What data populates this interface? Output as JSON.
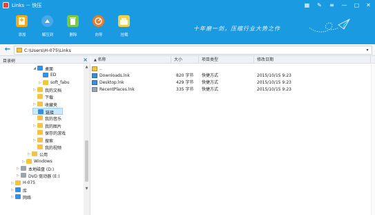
{
  "window": {
    "title": "Links － 快压",
    "controls": [
      "grid-icon",
      "wrench-icon",
      "menu-icon",
      "minimize-icon",
      "maximize-icon",
      "close-icon"
    ]
  },
  "toolbar": {
    "buttons": [
      {
        "label": "添加",
        "icon": "add-icon",
        "color": "#f5a623"
      },
      {
        "label": "解压到",
        "icon": "extract-icon",
        "color": "#4aa8ea"
      },
      {
        "label": "删除",
        "icon": "delete-icon",
        "color": "#7ac943"
      },
      {
        "label": "向导",
        "icon": "wizard-icon",
        "color": "#f07a2a"
      },
      {
        "label": "挂载",
        "icon": "mount-icon",
        "color": "#f1d04a"
      }
    ]
  },
  "slogan": "十年磨一剑，压缩行业大势之作",
  "address": {
    "path": "C:\\Users\\H-075\\Links"
  },
  "tree": {
    "title": "目录树",
    "items": [
      {
        "label": "桌面",
        "depth": 3,
        "expand": "◢",
        "icon": "#3a8fd8"
      },
      {
        "label": "ED",
        "depth": 4,
        "expand": "",
        "icon": "#3a8fd8"
      },
      {
        "label": "soft_fabu",
        "depth": 4,
        "expand": "▷",
        "icon": "#f3c443"
      },
      {
        "label": "我的文档",
        "depth": 3,
        "expand": "▷",
        "icon": "#f3c443"
      },
      {
        "label": "下载",
        "depth": 3,
        "expand": "",
        "icon": "#f3c443"
      },
      {
        "label": "收藏夹",
        "depth": 3,
        "expand": "▷",
        "icon": "#f3c443"
      },
      {
        "label": "链接",
        "depth": 3,
        "expand": "",
        "icon": "#3a8fd8",
        "selected": true
      },
      {
        "label": "我的音乐",
        "depth": 3,
        "expand": "",
        "icon": "#f3c443"
      },
      {
        "label": "我的图片",
        "depth": 3,
        "expand": "▷",
        "icon": "#f3c443"
      },
      {
        "label": "保存的游戏",
        "depth": 3,
        "expand": "",
        "icon": "#f3c443"
      },
      {
        "label": "搜索",
        "depth": 3,
        "expand": "▷",
        "icon": "#f3c443"
      },
      {
        "label": "我的视频",
        "depth": 3,
        "expand": "",
        "icon": "#f3c443"
      },
      {
        "label": "公用",
        "depth": 2,
        "expand": "▷",
        "icon": "#f3c443"
      },
      {
        "label": "Windows",
        "depth": 1,
        "expand": "▷",
        "icon": "#f3c443"
      },
      {
        "label": "本地磁盘 (D:)",
        "depth": 0,
        "expand": "▷",
        "icon": "#9aa4ad"
      },
      {
        "label": "DVD 驱动器 (E:)",
        "depth": 0,
        "expand": "▷",
        "icon": "#9aa4ad"
      },
      {
        "label": "H-075",
        "depth": -1,
        "expand": "▷",
        "icon": "#f3c443"
      },
      {
        "label": "库",
        "depth": -1,
        "expand": "▷",
        "icon": "#3a8fd8"
      },
      {
        "label": "网络",
        "depth": -1,
        "expand": "▷",
        "icon": "#3a8fd8"
      }
    ]
  },
  "list": {
    "columns": [
      "名称",
      "大小",
      "项目类型",
      "修改日期"
    ],
    "rows": [
      {
        "name": "..",
        "size": "",
        "type": "",
        "date": "",
        "icon": "#f3c443"
      },
      {
        "name": "Downloads.lnk",
        "size": "820 字节",
        "type": "快捷方式",
        "date": "2015/10/15 9:23",
        "icon": "#3a8fd8"
      },
      {
        "name": "Desktop.lnk",
        "size": "429 字节",
        "type": "快捷方式",
        "date": "2015/10/15 9:23",
        "icon": "#3a8fd8"
      },
      {
        "name": "RecentPlaces.lnk",
        "size": "335 字节",
        "type": "快捷方式",
        "date": "2015/10/15 9:23",
        "icon": "#9aa4ad"
      }
    ]
  }
}
